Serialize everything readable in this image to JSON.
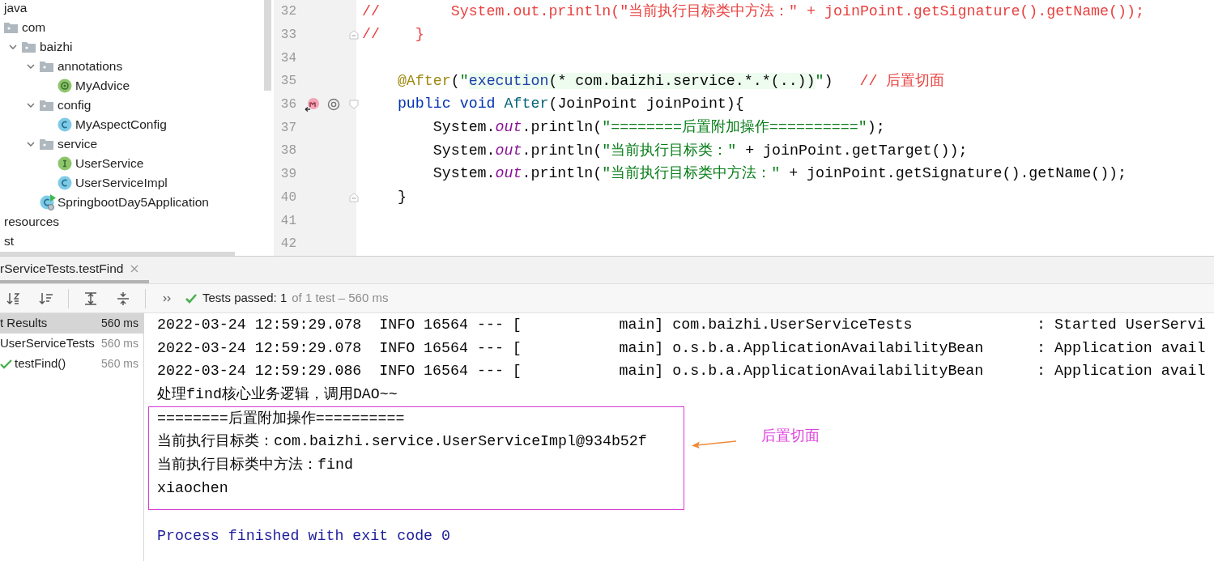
{
  "project_tree": {
    "items": [
      {
        "label": "java",
        "children": [
          {
            "label": "com",
            "kind": "folder",
            "children": [
              {
                "label": "baizhi",
                "kind": "folder",
                "expanded": true,
                "children": [
                  {
                    "label": "annotations",
                    "kind": "folder",
                    "expanded": true,
                    "children": [
                      {
                        "label": "MyAdvice",
                        "kind": "annotation"
                      }
                    ]
                  },
                  {
                    "label": "config",
                    "kind": "folder",
                    "expanded": true,
                    "children": [
                      {
                        "label": "MyAspectConfig",
                        "kind": "class"
                      }
                    ]
                  },
                  {
                    "label": "service",
                    "kind": "folder",
                    "expanded": true,
                    "children": [
                      {
                        "label": "UserService",
                        "kind": "interface"
                      },
                      {
                        "label": "UserServiceImpl",
                        "kind": "class"
                      }
                    ]
                  },
                  {
                    "label": "SpringbootDay5Application",
                    "kind": "app"
                  }
                ]
              }
            ]
          }
        ]
      },
      {
        "label": "resources"
      },
      {
        "label": "st"
      }
    ]
  },
  "editor": {
    "lines": [
      {
        "number": "32",
        "tokens": [
          {
            "text": "//        System.out.println(\"当前执行目标类中方法：\" + joinPoint.getSignature().getName());",
            "kind": "comment"
          }
        ]
      },
      {
        "number": "33",
        "fold": {
          "kind": "end"
        },
        "tokens": [
          {
            "text": "//    }",
            "kind": "comment"
          }
        ]
      },
      {
        "number": "34"
      },
      {
        "number": "35",
        "tokens": [
          {
            "text": "    @After",
            "kind": "annotation"
          },
          {
            "text": "(",
            "kind": "plain"
          },
          {
            "text": "\"",
            "kind": "string"
          },
          {
            "text": "execution",
            "kind": "injected-keyword"
          },
          {
            "text": "(* com.baizhi.service.*.*(..))",
            "kind": "injected"
          },
          {
            "text": "\"",
            "kind": "string"
          },
          {
            "text": ")   ",
            "kind": "plain"
          },
          {
            "text": "// 后置切面",
            "kind": "comment"
          }
        ]
      },
      {
        "number": "36",
        "fold": {
          "kind": "start"
        },
        "gutter": [
          {
            "kind": "method"
          },
          {
            "kind": "at"
          }
        ],
        "tokens": [
          {
            "text": "    public",
            "kind": "keyword"
          },
          {
            "text": " void",
            "kind": "keyword"
          },
          {
            "text": " After",
            "kind": "declaration"
          },
          {
            "text": "(JoinPoint joinPoint){",
            "kind": "plain"
          }
        ]
      },
      {
        "number": "37",
        "tokens": [
          {
            "text": "        System.",
            "kind": "plain"
          },
          {
            "text": "out",
            "kind": "field"
          },
          {
            "text": ".println(",
            "kind": "plain"
          },
          {
            "text": "\"========后置附加操作==========\"",
            "kind": "string"
          },
          {
            "text": ");",
            "kind": "plain"
          }
        ]
      },
      {
        "number": "38",
        "tokens": [
          {
            "text": "        System.",
            "kind": "plain"
          },
          {
            "text": "out",
            "kind": "field"
          },
          {
            "text": ".println(",
            "kind": "plain"
          },
          {
            "text": "\"当前执行目标类：\"",
            "kind": "string"
          },
          {
            "text": " + joinPoint.getTarget());",
            "kind": "plain"
          }
        ]
      },
      {
        "number": "39",
        "tokens": [
          {
            "text": "        System.",
            "kind": "plain"
          },
          {
            "text": "out",
            "kind": "field"
          },
          {
            "text": ".println(",
            "kind": "plain"
          },
          {
            "text": "\"当前执行目标类中方法：\"",
            "kind": "string"
          },
          {
            "text": " + joinPoint.getSignature().getName());",
            "kind": "plain"
          }
        ]
      },
      {
        "number": "40",
        "fold": {
          "kind": "end"
        },
        "tokens": [
          {
            "text": "    }",
            "kind": "plain"
          }
        ]
      },
      {
        "number": "41"
      },
      {
        "number": "42"
      }
    ]
  },
  "run_panel": {
    "tab": {
      "label": "rServiceTests.testFind",
      "selected": true
    },
    "toolbar": {
      "status": "Tests passed: 1",
      "detail": "of 1 test – 560 ms"
    },
    "results": [
      {
        "label": "t Results",
        "duration": "560 ms",
        "selected": true,
        "children": [
          {
            "label": "UserServiceTests",
            "duration": "560 ms",
            "selected": false,
            "children": [
              {
                "label": "testFind()",
                "duration": "560 ms",
                "selected": false,
                "passed": true
              }
            ]
          }
        ]
      }
    ],
    "console": {
      "lines_before": [
        "2022-03-24 12:59:29.078  INFO 16564 --- [           main] com.baizhi.UserServiceTests              : Started UserServi",
        "2022-03-24 12:59:29.078  INFO 16564 --- [           main] o.s.b.a.ApplicationAvailabilityBean      : Application avail",
        "2022-03-24 12:59:29.086  INFO 16564 --- [           main] o.s.b.a.ApplicationAvailabilityBean      : Application avail",
        "处理find核心业务逻辑，调用DAO~~"
      ],
      "framed_lines": [
        "========后置附加操作==========",
        "当前执行目标类：com.baizhi.service.UserServiceImpl@934b52f",
        "当前执行目标类中方法：find",
        "xiaochen"
      ],
      "lines_after": [
        "Process finished with exit code 0"
      ],
      "callout": {
        "label": "后置切面"
      }
    }
  }
}
